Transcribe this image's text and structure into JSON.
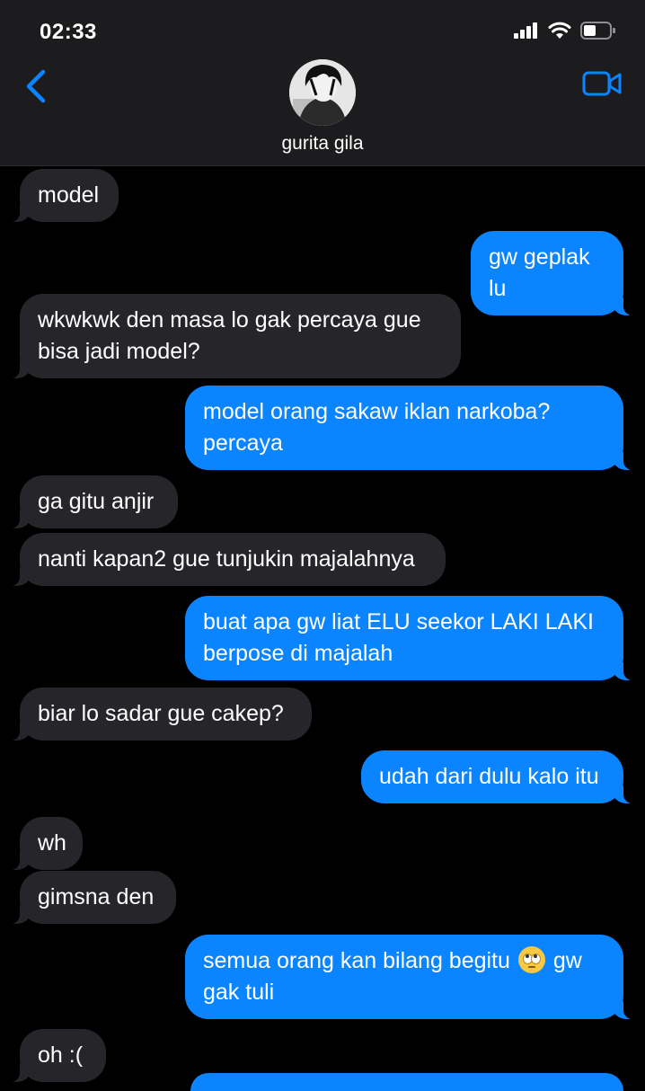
{
  "status": {
    "time": "02:33"
  },
  "contact": {
    "name": "gurita gila"
  },
  "colors": {
    "incoming": "#26252a",
    "outgoing": "#0a84ff",
    "accent": "#0a84ff",
    "header": "#1c1c1e"
  },
  "icons": [
    "back-chevron-icon",
    "video-call-icon",
    "signal-icon",
    "wifi-icon",
    "battery-icon",
    "eye-roll-emoji-icon"
  ],
  "messages": [
    {
      "from": "them",
      "text": "model"
    },
    {
      "from": "me",
      "text": "gw geplak lu"
    },
    {
      "from": "them",
      "text": "wkwkwk den masa lo gak percaya gue\nbisa jadi model?"
    },
    {
      "from": "me",
      "text": "model orang sakaw iklan narkoba?\npercaya"
    },
    {
      "from": "them",
      "text": "ga gitu anjir"
    },
    {
      "from": "them",
      "text": "nanti kapan2 gue tunjukin majalahnya"
    },
    {
      "from": "me",
      "text": "buat apa gw liat ELU seekor LAKI LAKI\nberpose di majalah"
    },
    {
      "from": "them",
      "text": "biar lo sadar gue cakep?"
    },
    {
      "from": "me",
      "text": "udah dari dulu kalo itu"
    },
    {
      "from": "them",
      "text": "wh"
    },
    {
      "from": "them",
      "text": "gimsna den"
    },
    {
      "from": "me",
      "text_before": "semua orang kan bilang begitu",
      "text_after": "gw\ngak tuli"
    },
    {
      "from": "them",
      "text": "oh :("
    }
  ]
}
